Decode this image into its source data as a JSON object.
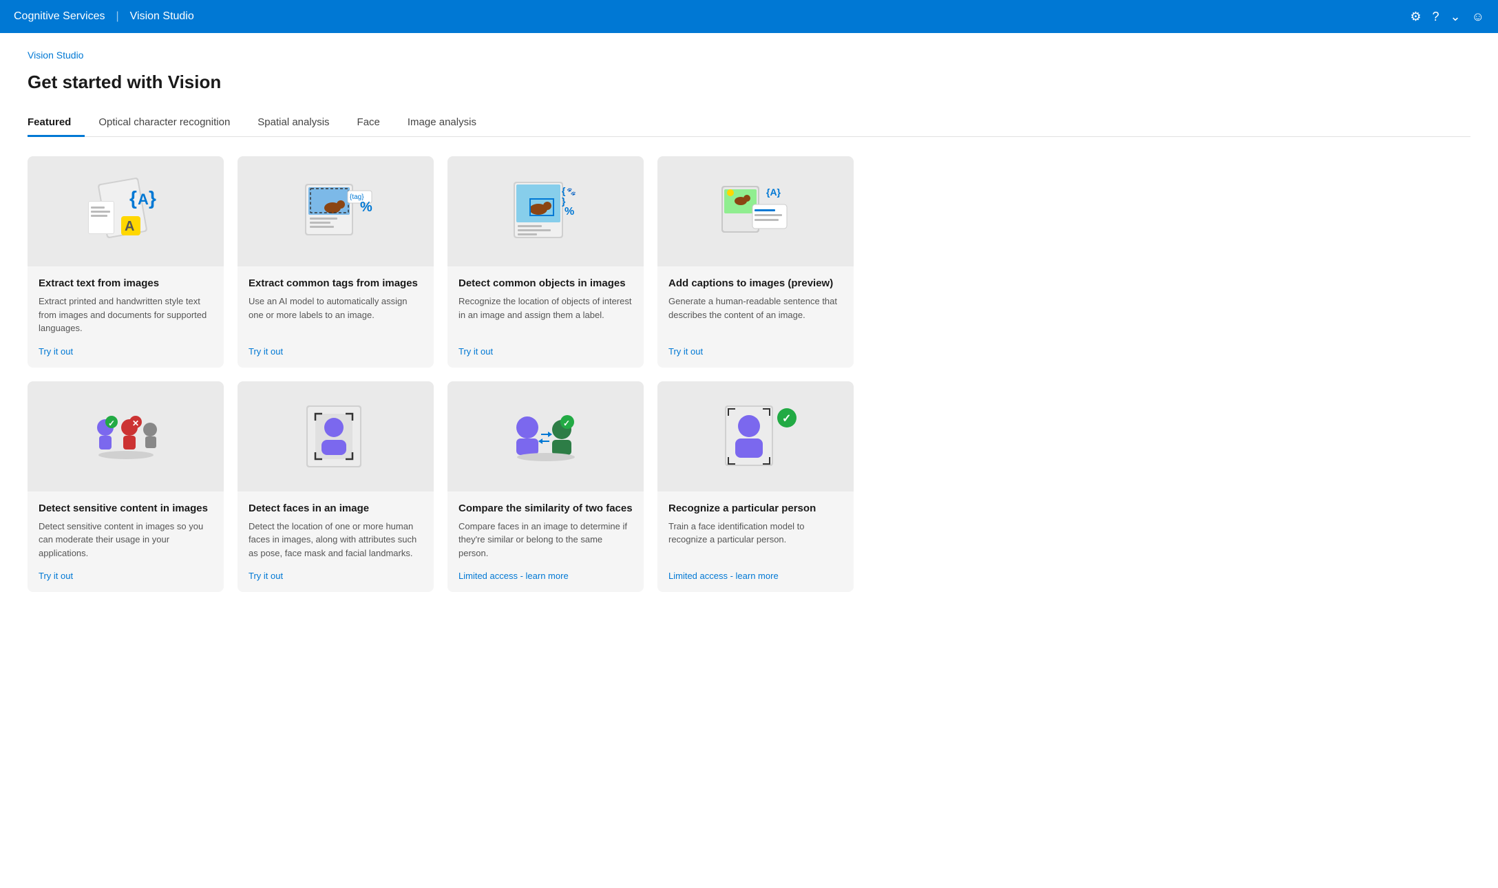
{
  "nav": {
    "title": "Cognitive Services",
    "separator": "|",
    "subtitle": "Vision Studio",
    "icons": [
      "gear",
      "help",
      "chevron-down",
      "user-circle"
    ]
  },
  "breadcrumb": "Vision Studio",
  "page_title": "Get started with Vision",
  "tabs": [
    {
      "id": "featured",
      "label": "Featured",
      "active": true
    },
    {
      "id": "ocr",
      "label": "Optical character recognition",
      "active": false
    },
    {
      "id": "spatial",
      "label": "Spatial analysis",
      "active": false
    },
    {
      "id": "face",
      "label": "Face",
      "active": false
    },
    {
      "id": "image-analysis",
      "label": "Image analysis",
      "active": false
    }
  ],
  "cards_row1": [
    {
      "id": "extract-text",
      "title": "Extract text from images",
      "description": "Extract printed and handwritten style text from images and documents for supported languages.",
      "link_label": "Try it out",
      "link_type": "try"
    },
    {
      "id": "extract-tags",
      "title": "Extract common tags from images",
      "description": "Use an AI model to automatically assign one or more labels to an image.",
      "link_label": "Try it out",
      "link_type": "try"
    },
    {
      "id": "detect-objects",
      "title": "Detect common objects in images",
      "description": "Recognize the location of objects of interest in an image and assign them a label.",
      "link_label": "Try it out",
      "link_type": "try"
    },
    {
      "id": "add-captions",
      "title": "Add captions to images (preview)",
      "description": "Generate a human-readable sentence that describes the content of an image.",
      "link_label": "Try it out",
      "link_type": "try"
    }
  ],
  "cards_row2": [
    {
      "id": "detect-sensitive",
      "title": "Detect sensitive content in images",
      "description": "Detect sensitive content in images so you can moderate their usage in your applications.",
      "link_label": "Try it out",
      "link_type": "try"
    },
    {
      "id": "detect-faces",
      "title": "Detect faces in an image",
      "description": "Detect the location of one or more human faces in images, along with attributes such as pose, face mask and facial landmarks.",
      "link_label": "Try it out",
      "link_type": "try"
    },
    {
      "id": "compare-faces",
      "title": "Compare the similarity of two faces",
      "description": "Compare faces in an image to determine if they're similar or belong to the same person.",
      "link_label": "Limited access - learn more",
      "link_type": "limited"
    },
    {
      "id": "recognize-person",
      "title": "Recognize a particular person",
      "description": "Train a face identification model to recognize a particular person.",
      "link_label": "Limited access - learn more",
      "link_type": "limited"
    }
  ]
}
